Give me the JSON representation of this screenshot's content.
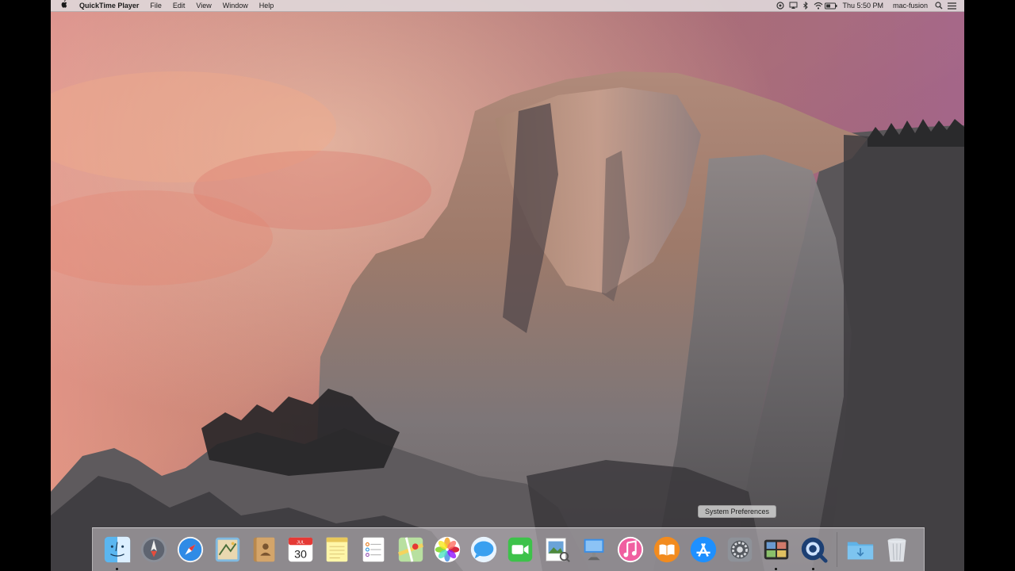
{
  "menubar": {
    "apple_icon": "apple-icon",
    "app_name": "QuickTime Player",
    "menus": [
      "File",
      "Edit",
      "View",
      "Window",
      "Help"
    ],
    "clock": "Thu 5:50 PM",
    "user": "mac-fusion",
    "status_icons": [
      "display-icon",
      "airplay-icon",
      "bluetooth-icon",
      "wifi-icon",
      "battery-icon",
      "spotlight-icon",
      "notification-center-icon"
    ]
  },
  "dock": {
    "tooltip": "System Preferences",
    "calendar": {
      "month": "JUL",
      "day": "30"
    },
    "apps": [
      {
        "name": "Finder",
        "icon": "finder-icon",
        "running": true
      },
      {
        "name": "Launchpad",
        "icon": "launchpad-icon",
        "running": false
      },
      {
        "name": "Safari",
        "icon": "safari-icon",
        "running": false
      },
      {
        "name": "Mail",
        "icon": "mail-icon",
        "running": false
      },
      {
        "name": "Contacts",
        "icon": "contacts-icon",
        "running": false
      },
      {
        "name": "Calendar",
        "icon": "calendar-icon",
        "running": false
      },
      {
        "name": "Notes",
        "icon": "notes-icon",
        "running": false
      },
      {
        "name": "Reminders",
        "icon": "reminders-icon",
        "running": false
      },
      {
        "name": "Maps",
        "icon": "maps-icon",
        "running": false
      },
      {
        "name": "Photos",
        "icon": "photos-icon",
        "running": false
      },
      {
        "name": "Messages",
        "icon": "messages-icon",
        "running": false
      },
      {
        "name": "FaceTime",
        "icon": "facetime-icon",
        "running": false
      },
      {
        "name": "Preview",
        "icon": "preview-icon",
        "running": false
      },
      {
        "name": "Keynote",
        "icon": "keynote-icon",
        "running": false
      },
      {
        "name": "iTunes",
        "icon": "itunes-icon",
        "running": false
      },
      {
        "name": "iBooks",
        "icon": "ibooks-icon",
        "running": false
      },
      {
        "name": "App Store",
        "icon": "app-store-icon",
        "running": false
      },
      {
        "name": "System Preferences",
        "icon": "system-preferences-icon",
        "running": false
      },
      {
        "name": "Photo Booth",
        "icon": "photo-booth-icon",
        "running": true
      },
      {
        "name": "QuickTime Player",
        "icon": "quicktime-icon",
        "running": true
      }
    ],
    "trailing": [
      {
        "name": "Downloads",
        "icon": "folder-icon"
      },
      {
        "name": "Trash",
        "icon": "trash-icon"
      }
    ]
  },
  "colors": {
    "sky_top": "#c77b8a",
    "sky_bottom": "#e88d6c",
    "rock": "#8f8c8e",
    "menubar": "#ded6d8"
  }
}
